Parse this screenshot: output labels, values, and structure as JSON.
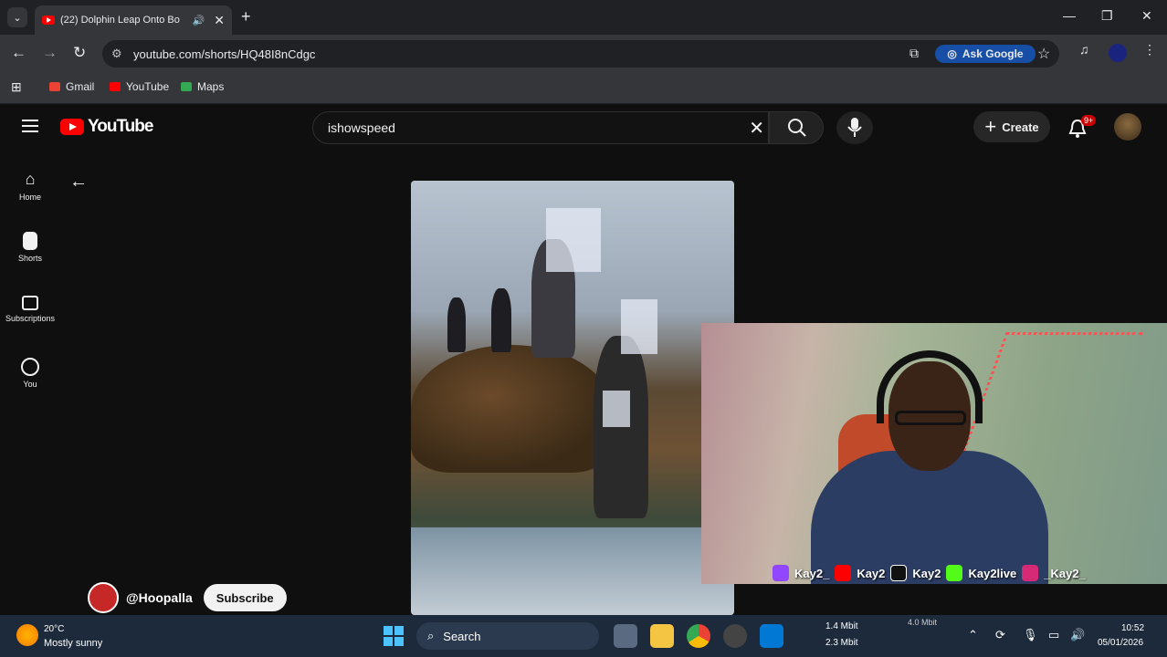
{
  "browser": {
    "tab_title": "(22) Dolphin Leap Onto Bo",
    "tab_audio_icon": "speaker-icon",
    "url": "youtube.com/shorts/HQ48I8nCdgc",
    "ask_google_label": "Ask Google",
    "bookmarks": [
      {
        "label": "Gmail",
        "icon": "gmail-icon",
        "color": "#ea4335"
      },
      {
        "label": "YouTube",
        "icon": "youtube-icon",
        "color": "#ff0000"
      },
      {
        "label": "Maps",
        "icon": "maps-icon",
        "color": "#34a853"
      }
    ]
  },
  "youtube": {
    "logo_text": "YouTube",
    "search_value": "ishowspeed",
    "create_label": "Create",
    "notification_badge": "9+",
    "guide": [
      {
        "label": "Home",
        "icon": "home-icon"
      },
      {
        "label": "Shorts",
        "icon": "shorts-icon"
      },
      {
        "label": "Subscriptions",
        "icon": "subscriptions-icon"
      },
      {
        "label": "You",
        "icon": "you-icon"
      }
    ],
    "channel_handle": "@Hoopalla",
    "subscribe_label": "Subscribe"
  },
  "overlay": {
    "socials": [
      {
        "handle": "Kay2_",
        "icon": "twitch-icon",
        "color": "#9146ff"
      },
      {
        "handle": "Kay2",
        "icon": "youtube-icon",
        "color": "#ff0000"
      },
      {
        "handle": "Kay2",
        "icon": "tiktok-icon",
        "color": "#111111"
      },
      {
        "handle": "Kay2live",
        "icon": "kick-icon",
        "color": "#53fc18"
      },
      {
        "handle": "_Kay2_",
        "icon": "instagram-icon",
        "color": "#d62976"
      }
    ]
  },
  "taskbar": {
    "weather_temp": "20°C",
    "weather_desc": "Mostly sunny",
    "search_label": "Search",
    "net_up": "1.4 Mbit",
    "net_down": "2.3 Mbit",
    "net_total": "4.0 Mbit",
    "time": "10:52",
    "date": "05/01/2026"
  }
}
